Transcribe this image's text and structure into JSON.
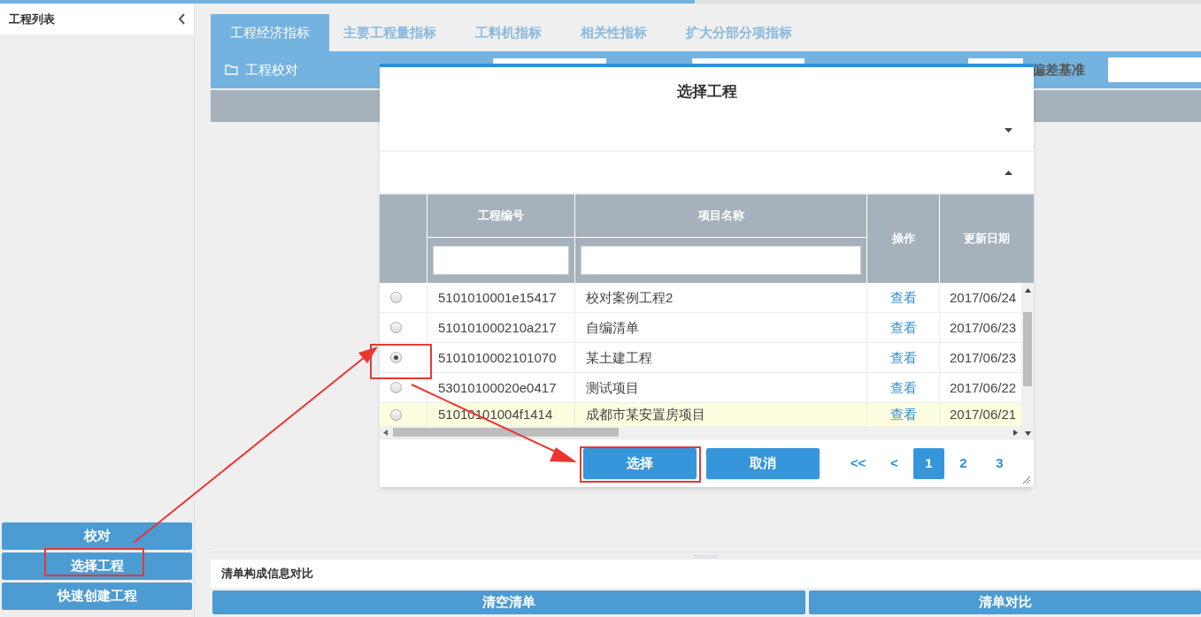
{
  "sidebar": {
    "title": "工程列表",
    "buttons": [
      "校对",
      "选择工程",
      "快速创建工程"
    ]
  },
  "tabs": [
    {
      "label": "工程经济指标",
      "selected": true
    },
    {
      "label": "主要工程量指标",
      "selected": false
    },
    {
      "label": "工料机指标",
      "selected": false
    },
    {
      "label": "相关性指标",
      "selected": false
    },
    {
      "label": "扩大分部分项指标",
      "selected": false
    }
  ],
  "toolbar": {
    "title": "工程校对",
    "deviation_label": "偏差基准"
  },
  "dialog": {
    "title": "选择工程",
    "sections": [
      {
        "expanded": false
      },
      {
        "expanded": true
      }
    ],
    "table": {
      "columns": [
        "工程编号",
        "项目名称",
        "操作",
        "更新日期"
      ],
      "rows": [
        {
          "selected": false,
          "highlighted": false,
          "code": "5101010001e15417",
          "name": "校对案例工程2",
          "action": "查看",
          "date": "2017/06/24"
        },
        {
          "selected": false,
          "highlighted": false,
          "code": "510101000210a217",
          "name": "自编清单",
          "action": "查看",
          "date": "2017/06/23"
        },
        {
          "selected": true,
          "highlighted": false,
          "code": "5101010002101070",
          "name": "某土建工程",
          "action": "查看",
          "date": "2017/06/23"
        },
        {
          "selected": false,
          "highlighted": false,
          "code": "53010100020e0417",
          "name": "测试项目",
          "action": "查看",
          "date": "2017/06/22"
        },
        {
          "selected": false,
          "highlighted": true,
          "code": "51010101004f1414",
          "name": "成都市某安置房项目",
          "action": "查看",
          "date": "2017/06/21"
        }
      ]
    },
    "buttons": [
      "选择",
      "取消"
    ],
    "pagination": [
      {
        "label": "<<",
        "selected": false
      },
      {
        "label": "<",
        "selected": false
      },
      {
        "label": "1",
        "selected": true
      },
      {
        "label": "2",
        "selected": false
      },
      {
        "label": "3",
        "selected": false
      }
    ]
  },
  "bottom": {
    "title": "清单构成信息对比",
    "buttons": [
      "清空清单",
      "清单对比"
    ]
  }
}
